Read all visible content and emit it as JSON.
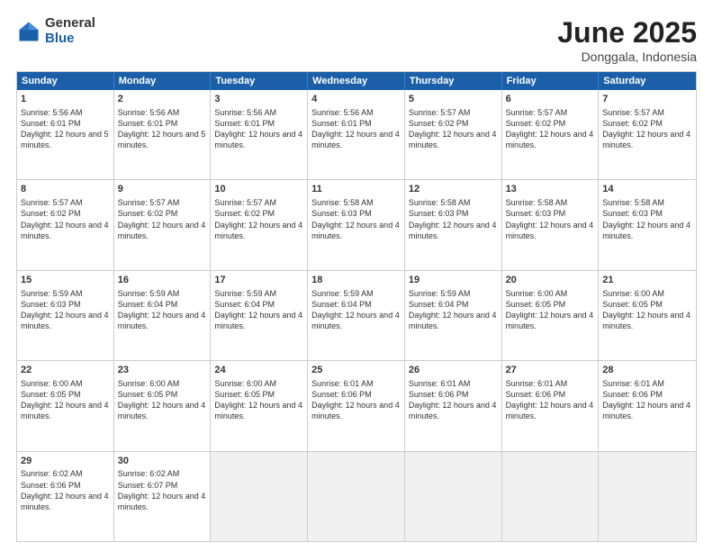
{
  "logo": {
    "general": "General",
    "blue": "Blue"
  },
  "title": {
    "month": "June 2025",
    "location": "Donggala, Indonesia"
  },
  "header": {
    "days": [
      "Sunday",
      "Monday",
      "Tuesday",
      "Wednesday",
      "Thursday",
      "Friday",
      "Saturday"
    ]
  },
  "weeks": [
    [
      {
        "day": "1",
        "sunrise": "Sunrise: 5:56 AM",
        "sunset": "Sunset: 6:01 PM",
        "daylight": "Daylight: 12 hours and 5 minutes.",
        "empty": false
      },
      {
        "day": "2",
        "sunrise": "Sunrise: 5:56 AM",
        "sunset": "Sunset: 6:01 PM",
        "daylight": "Daylight: 12 hours and 5 minutes.",
        "empty": false
      },
      {
        "day": "3",
        "sunrise": "Sunrise: 5:56 AM",
        "sunset": "Sunset: 6:01 PM",
        "daylight": "Daylight: 12 hours and 4 minutes.",
        "empty": false
      },
      {
        "day": "4",
        "sunrise": "Sunrise: 5:56 AM",
        "sunset": "Sunset: 6:01 PM",
        "daylight": "Daylight: 12 hours and 4 minutes.",
        "empty": false
      },
      {
        "day": "5",
        "sunrise": "Sunrise: 5:57 AM",
        "sunset": "Sunset: 6:02 PM",
        "daylight": "Daylight: 12 hours and 4 minutes.",
        "empty": false
      },
      {
        "day": "6",
        "sunrise": "Sunrise: 5:57 AM",
        "sunset": "Sunset: 6:02 PM",
        "daylight": "Daylight: 12 hours and 4 minutes.",
        "empty": false
      },
      {
        "day": "7",
        "sunrise": "Sunrise: 5:57 AM",
        "sunset": "Sunset: 6:02 PM",
        "daylight": "Daylight: 12 hours and 4 minutes.",
        "empty": false
      }
    ],
    [
      {
        "day": "8",
        "sunrise": "Sunrise: 5:57 AM",
        "sunset": "Sunset: 6:02 PM",
        "daylight": "Daylight: 12 hours and 4 minutes.",
        "empty": false
      },
      {
        "day": "9",
        "sunrise": "Sunrise: 5:57 AM",
        "sunset": "Sunset: 6:02 PM",
        "daylight": "Daylight: 12 hours and 4 minutes.",
        "empty": false
      },
      {
        "day": "10",
        "sunrise": "Sunrise: 5:57 AM",
        "sunset": "Sunset: 6:02 PM",
        "daylight": "Daylight: 12 hours and 4 minutes.",
        "empty": false
      },
      {
        "day": "11",
        "sunrise": "Sunrise: 5:58 AM",
        "sunset": "Sunset: 6:03 PM",
        "daylight": "Daylight: 12 hours and 4 minutes.",
        "empty": false
      },
      {
        "day": "12",
        "sunrise": "Sunrise: 5:58 AM",
        "sunset": "Sunset: 6:03 PM",
        "daylight": "Daylight: 12 hours and 4 minutes.",
        "empty": false
      },
      {
        "day": "13",
        "sunrise": "Sunrise: 5:58 AM",
        "sunset": "Sunset: 6:03 PM",
        "daylight": "Daylight: 12 hours and 4 minutes.",
        "empty": false
      },
      {
        "day": "14",
        "sunrise": "Sunrise: 5:58 AM",
        "sunset": "Sunset: 6:03 PM",
        "daylight": "Daylight: 12 hours and 4 minutes.",
        "empty": false
      }
    ],
    [
      {
        "day": "15",
        "sunrise": "Sunrise: 5:59 AM",
        "sunset": "Sunset: 6:03 PM",
        "daylight": "Daylight: 12 hours and 4 minutes.",
        "empty": false
      },
      {
        "day": "16",
        "sunrise": "Sunrise: 5:59 AM",
        "sunset": "Sunset: 6:04 PM",
        "daylight": "Daylight: 12 hours and 4 minutes.",
        "empty": false
      },
      {
        "day": "17",
        "sunrise": "Sunrise: 5:59 AM",
        "sunset": "Sunset: 6:04 PM",
        "daylight": "Daylight: 12 hours and 4 minutes.",
        "empty": false
      },
      {
        "day": "18",
        "sunrise": "Sunrise: 5:59 AM",
        "sunset": "Sunset: 6:04 PM",
        "daylight": "Daylight: 12 hours and 4 minutes.",
        "empty": false
      },
      {
        "day": "19",
        "sunrise": "Sunrise: 5:59 AM",
        "sunset": "Sunset: 6:04 PM",
        "daylight": "Daylight: 12 hours and 4 minutes.",
        "empty": false
      },
      {
        "day": "20",
        "sunrise": "Sunrise: 6:00 AM",
        "sunset": "Sunset: 6:05 PM",
        "daylight": "Daylight: 12 hours and 4 minutes.",
        "empty": false
      },
      {
        "day": "21",
        "sunrise": "Sunrise: 6:00 AM",
        "sunset": "Sunset: 6:05 PM",
        "daylight": "Daylight: 12 hours and 4 minutes.",
        "empty": false
      }
    ],
    [
      {
        "day": "22",
        "sunrise": "Sunrise: 6:00 AM",
        "sunset": "Sunset: 6:05 PM",
        "daylight": "Daylight: 12 hours and 4 minutes.",
        "empty": false
      },
      {
        "day": "23",
        "sunrise": "Sunrise: 6:00 AM",
        "sunset": "Sunset: 6:05 PM",
        "daylight": "Daylight: 12 hours and 4 minutes.",
        "empty": false
      },
      {
        "day": "24",
        "sunrise": "Sunrise: 6:00 AM",
        "sunset": "Sunset: 6:05 PM",
        "daylight": "Daylight: 12 hours and 4 minutes.",
        "empty": false
      },
      {
        "day": "25",
        "sunrise": "Sunrise: 6:01 AM",
        "sunset": "Sunset: 6:06 PM",
        "daylight": "Daylight: 12 hours and 4 minutes.",
        "empty": false
      },
      {
        "day": "26",
        "sunrise": "Sunrise: 6:01 AM",
        "sunset": "Sunset: 6:06 PM",
        "daylight": "Daylight: 12 hours and 4 minutes.",
        "empty": false
      },
      {
        "day": "27",
        "sunrise": "Sunrise: 6:01 AM",
        "sunset": "Sunset: 6:06 PM",
        "daylight": "Daylight: 12 hours and 4 minutes.",
        "empty": false
      },
      {
        "day": "28",
        "sunrise": "Sunrise: 6:01 AM",
        "sunset": "Sunset: 6:06 PM",
        "daylight": "Daylight: 12 hours and 4 minutes.",
        "empty": false
      }
    ],
    [
      {
        "day": "29",
        "sunrise": "Sunrise: 6:02 AM",
        "sunset": "Sunset: 6:06 PM",
        "daylight": "Daylight: 12 hours and 4 minutes.",
        "empty": false
      },
      {
        "day": "30",
        "sunrise": "Sunrise: 6:02 AM",
        "sunset": "Sunset: 6:07 PM",
        "daylight": "Daylight: 12 hours and 4 minutes.",
        "empty": false
      },
      {
        "day": "",
        "sunrise": "",
        "sunset": "",
        "daylight": "",
        "empty": true
      },
      {
        "day": "",
        "sunrise": "",
        "sunset": "",
        "daylight": "",
        "empty": true
      },
      {
        "day": "",
        "sunrise": "",
        "sunset": "",
        "daylight": "",
        "empty": true
      },
      {
        "day": "",
        "sunrise": "",
        "sunset": "",
        "daylight": "",
        "empty": true
      },
      {
        "day": "",
        "sunrise": "",
        "sunset": "",
        "daylight": "",
        "empty": true
      }
    ]
  ]
}
